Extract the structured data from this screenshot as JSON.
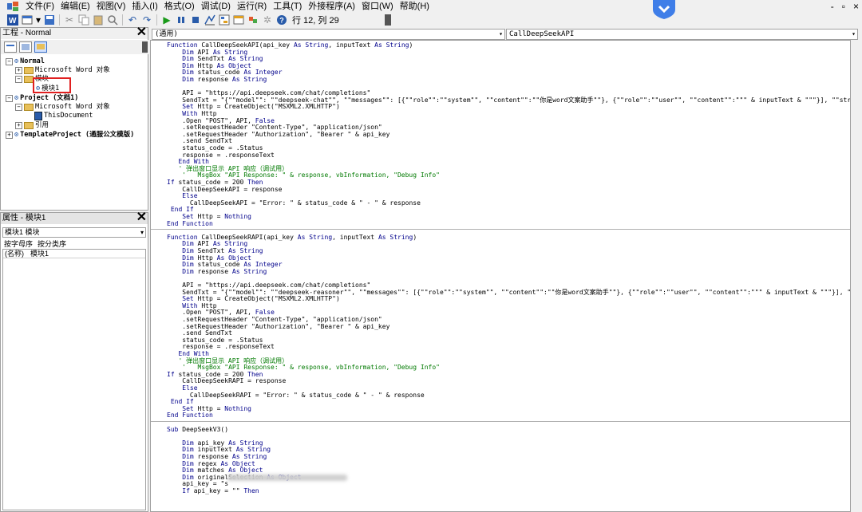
{
  "menu": [
    "文件(F)",
    "编辑(E)",
    "视图(V)",
    "插入(I)",
    "格式(O)",
    "调试(D)",
    "运行(R)",
    "工具(T)",
    "外接程序(A)",
    "窗口(W)",
    "帮助(H)"
  ],
  "window_controls": [
    "-",
    "▫",
    "×"
  ],
  "status": "行 12, 列 29",
  "project_panel": {
    "title": "工程 - Normal",
    "tree": [
      {
        "label": "Normal",
        "bold": true
      },
      {
        "label": "Microsoft Word 对象"
      },
      {
        "label": "模块"
      },
      {
        "label": "模块1"
      },
      {
        "label": "Project (文档1)",
        "bold": true
      },
      {
        "label": "Microsoft Word 对象"
      },
      {
        "label": "ThisDocument"
      },
      {
        "label": "引用"
      },
      {
        "label": "TemplateProject (通服公文模版)",
        "bold": true
      }
    ]
  },
  "properties_panel": {
    "title": "属性 - 模块1",
    "object": "模块1 模块",
    "tabs": [
      "按字母序",
      "按分类序"
    ],
    "row_name": "(名称)",
    "row_value": "模块1"
  },
  "editor": {
    "object_combo": "(通用)",
    "proc_combo": "CallDeepSeekAPI",
    "lines": [
      "Function CallDeepSeekAPI(api_key As String, inputText As String)",
      "    Dim API As String",
      "    Dim SendTxt As String",
      "    Dim Http As Object",
      "    Dim status_code As Integer",
      "    Dim response As String",
      "",
      "    API = \"https://api.deepseek.com/chat/completions\"",
      "    SendTxt = \"{\"\"model\"\": \"\"deepseek-chat\"\", \"\"messages\"\": [{\"\"role\"\":\"\"system\"\", \"\"content\"\":\"\"你是word文案助手\"\"}, {\"\"role\"\":\"\"user\"\", \"\"content\"\":\"\"\" & inputText & \"\"\"}], \"\"stream\"\": false}\"",
      "    Set Http = CreateObject(\"MSXML2.XMLHTTP\")",
      "    With Http",
      "    .Open \"POST\", API, False",
      "    .setRequestHeader \"Content-Type\", \"application/json\"",
      "    .setRequestHeader \"Authorization\", \"Bearer \" & api_key",
      "    .send SendTxt",
      "    status_code = .Status",
      "    response = .responseText",
      "   End With",
      "   ' 弹出窗口显示 API 响应（调试用）",
      "    '   MsgBox \"API Response: \" & response, vbInformation, \"Debug Info\"",
      "If status_code = 200 Then",
      "    CallDeepSeekAPI = response",
      "    Else",
      "      CallDeepSeekAPI = \"Error: \" & status_code & \" - \" & response",
      " End If",
      "    Set Http = Nothing",
      "End Function",
      "",
      "Function CallDeepSeekRAPI(api_key As String, inputText As String)",
      "    Dim API As String",
      "    Dim SendTxt As String",
      "    Dim Http As Object",
      "    Dim status_code As Integer",
      "    Dim response As String",
      "",
      "    API = \"https://api.deepseek.com/chat/completions\"",
      "    SendTxt = \"{\"\"model\"\": \"\"deepseek-reasoner\"\", \"\"messages\"\": [{\"\"role\"\":\"\"system\"\", \"\"content\"\":\"\"你是word文案助手\"\"}, {\"\"role\"\":\"\"user\"\", \"\"content\"\":\"\"\" & inputText & \"\"\"}], \"\"stream\"\": false}\"",
      "    Set Http = CreateObject(\"MSXML2.XMLHTTP\")",
      "    With Http",
      "    .Open \"POST\", API, False",
      "    .setRequestHeader \"Content-Type\", \"application/json\"",
      "    .setRequestHeader \"Authorization\", \"Bearer \" & api_key",
      "    .send SendTxt",
      "    status_code = .Status",
      "    response = .responseText",
      "   End With",
      "   ' 弹出窗口显示 API 响应（调试用）",
      "    '   MsgBox \"API Response: \" & response, vbInformation, \"Debug Info\"",
      "If status_code = 200 Then",
      "    CallDeepSeekRAPI = response",
      "    Else",
      "      CallDeepSeekRAPI = \"Error: \" & status_code & \" - \" & response",
      " End If",
      "    Set Http = Nothing",
      "End Function",
      "",
      "Sub DeepSeekV3()",
      "",
      "    Dim api_key As String",
      "    Dim inputText As String",
      "    Dim response As String",
      "    Dim regex As Object",
      "    Dim matches As Object",
      "    Dim originalSelection As Object",
      "    api_key = \"s",
      "    If api_key = \"\" Then"
    ]
  }
}
